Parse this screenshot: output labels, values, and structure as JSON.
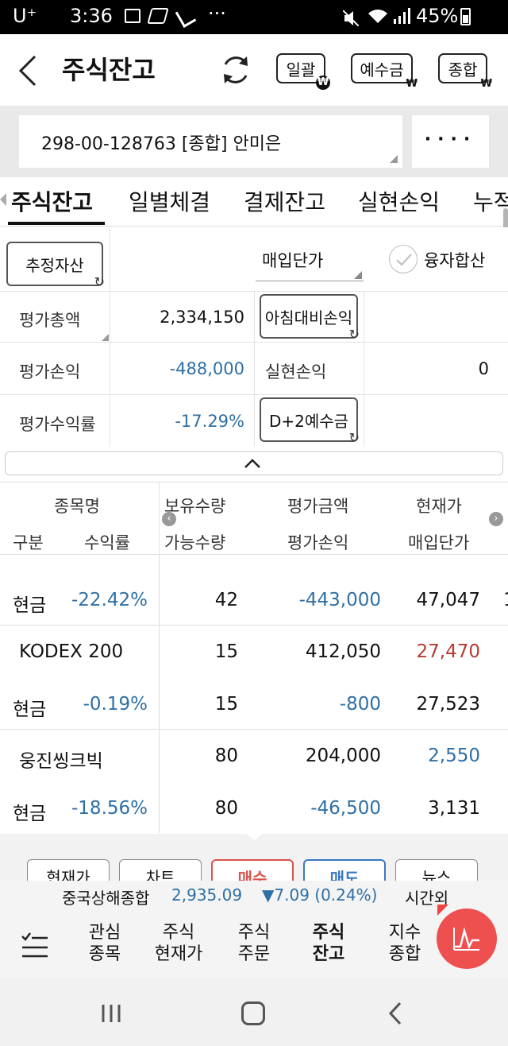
{
  "status_bar": {
    "carrier": "U⁺",
    "time": "3:36",
    "dots": "···",
    "battery": "45%"
  },
  "header": {
    "title": "주식잔고",
    "btn_bulk": "일괄",
    "btn_deposit": "예수금",
    "btn_total": "종합",
    "won_sign": "₩"
  },
  "account": {
    "number": "298-00-128763 [종합] 안미은",
    "more": "····"
  },
  "tabs": [
    "주식잔고",
    "일별체결",
    "결제잔고",
    "실현손익",
    "누적"
  ],
  "summary": {
    "estimated_assets_btn": "추정자산",
    "purchase_price_select": "매입단가",
    "margin_include": "융자합산",
    "eval_total_label": "평가총액",
    "eval_total_value": "2,334,150",
    "morning_pl_btn": "아침대비손익",
    "eval_pl_label": "평가손익",
    "eval_pl_value": "-488,000",
    "realized_pl_label": "실현손익",
    "realized_pl_value": "0",
    "eval_return_label": "평가수익률",
    "eval_return_value": "-17.29%",
    "d2_deposit_btn": "D+2예수금"
  },
  "table": {
    "headers_top": [
      "종목명",
      "보유수량",
      "평가금액",
      "현재가"
    ],
    "headers_bottom": [
      "구분",
      "수익률",
      "가능수량",
      "평가손익",
      "매입단가"
    ],
    "partial_row": {
      "type": "현금",
      "return": "-22.42%",
      "available_qty": "42",
      "eval_pl": "-443,000",
      "purchase_price": "47,047",
      "trailing": "1"
    },
    "rows": [
      {
        "name": "KODEX 200",
        "qty": "15",
        "eval_amount": "412,050",
        "current_price": "27,470",
        "type": "현금",
        "return": "-0.19%",
        "available_qty": "15",
        "eval_pl": "-800",
        "purchase_price": "27,523"
      },
      {
        "name": "웅진씽크빅",
        "qty": "80",
        "eval_amount": "204,000",
        "current_price": "2,550",
        "type": "현금",
        "return": "-18.56%",
        "available_qty": "80",
        "eval_pl": "-46,500",
        "purchase_price": "3,131"
      }
    ]
  },
  "actions": [
    "현재가",
    "차트",
    "매수",
    "매도",
    "뉴스"
  ],
  "ticker": {
    "index_name": "중국상해종합",
    "value": "2,935.09",
    "change": "▼7.09 (0.24%)",
    "session": "시간외"
  },
  "bottom_nav": [
    {
      "line1": "관심",
      "line2": "종목"
    },
    {
      "line1": "주식",
      "line2": "현재가"
    },
    {
      "line1": "주식",
      "line2": "주문"
    },
    {
      "line1": "주식",
      "line2": "잔고"
    },
    {
      "line1": "지수",
      "line2": "종합"
    }
  ],
  "colors": {
    "negative_blue": "#2e6fa6",
    "positive_red": "#b63a32",
    "fab_red": "#ee4f4f"
  }
}
